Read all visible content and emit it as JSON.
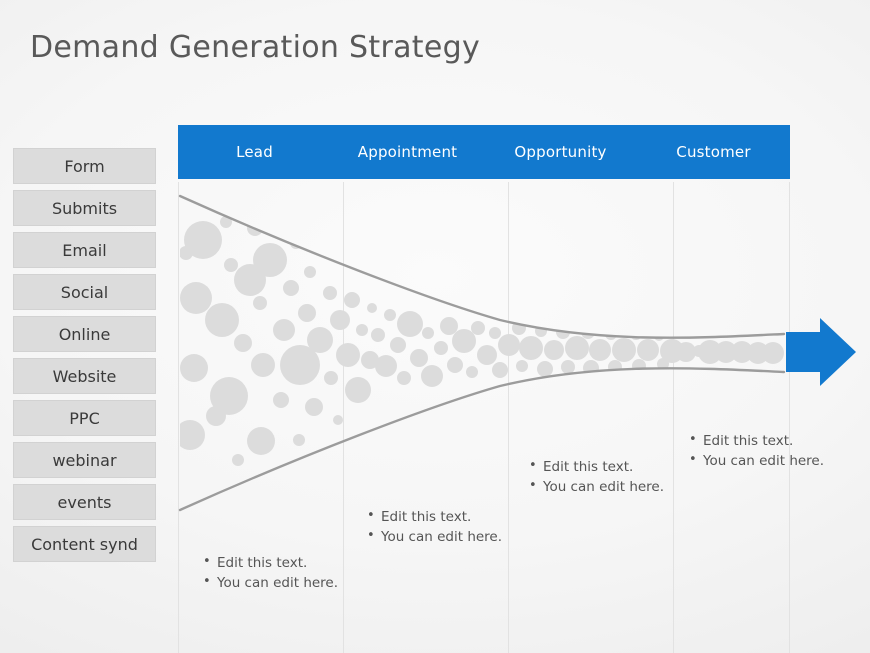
{
  "slide": {
    "title": "Demand Generation Strategy",
    "background_color": "#f2f2f2",
    "accent_color": "#1279ce"
  },
  "sidebar": {
    "items": [
      {
        "label": "Form"
      },
      {
        "label": "Submits"
      },
      {
        "label": "Email"
      },
      {
        "label": "Social"
      },
      {
        "label": "Online"
      },
      {
        "label": "Website"
      },
      {
        "label": "PPC"
      },
      {
        "label": "webinar"
      },
      {
        "label": "events"
      },
      {
        "label": "Content synd"
      }
    ]
  },
  "header": {
    "background_color": "#1279ce",
    "text_color": "#ffffff",
    "stages": [
      {
        "label": "Lead"
      },
      {
        "label": "Appointment"
      },
      {
        "label": "Opportunity"
      },
      {
        "label": "Customer"
      }
    ]
  },
  "columns": [
    {
      "stage": "Lead",
      "bullets": [
        "Edit this text.",
        "You can edit here."
      ]
    },
    {
      "stage": "Appointment",
      "bullets": [
        "Edit this text.",
        "You can edit here."
      ]
    },
    {
      "stage": "Opportunity",
      "bullets": [
        "Edit this text.",
        "You can edit here."
      ]
    },
    {
      "stage": "Customer",
      "bullets": [
        "Edit this text.",
        "You can edit here."
      ]
    }
  ],
  "funnel": {
    "outline_color": "#9c9c9c",
    "bubble_color": "#dcdcdc",
    "arrow_color": "#1279ce",
    "arrow_icon": "arrow-right-icon"
  }
}
